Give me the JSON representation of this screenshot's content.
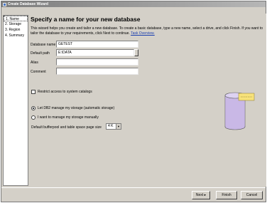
{
  "window": {
    "title": "Create Database Wizard"
  },
  "nav": {
    "items": [
      {
        "label": "1. Name"
      },
      {
        "label": "2. Storage"
      },
      {
        "label": "3. Region"
      },
      {
        "label": "4. Summary"
      }
    ]
  },
  "main": {
    "heading": "Specify a name for your new database",
    "intro": "This wizard helps you create and tailor a new database. To create a basic database, type a new name, select a drive, and click Finish. If you want to tailor the database to your requirements, click Next to continue.",
    "intro_link": "Task Overview.",
    "fields": {
      "database_name_label": "Database name",
      "database_name_value": "GETEST",
      "default_path_label": "Default path",
      "default_path_value": "E:\\DATA",
      "alias_label": "Alias",
      "alias_value": "",
      "comment_label": "Comment",
      "comment_value": ""
    },
    "restrict_access_label": "Restrict access to system catalogs",
    "storage_options": [
      {
        "label": "Let DB2 manage my storage (automatic storage)",
        "checked": true
      },
      {
        "label": "I want to manage my storage manually",
        "checked": false
      }
    ],
    "page_size_label": "Default bufferpool and table space page size",
    "page_size_value": "4 K"
  },
  "buttons": {
    "next": "Next",
    "finish": "Finish",
    "cancel": "Cancel"
  },
  "colors": {
    "dialog_bg": "#d4d0c8",
    "link": "#1a3fb0",
    "cylinder": "#c9b8e6"
  }
}
